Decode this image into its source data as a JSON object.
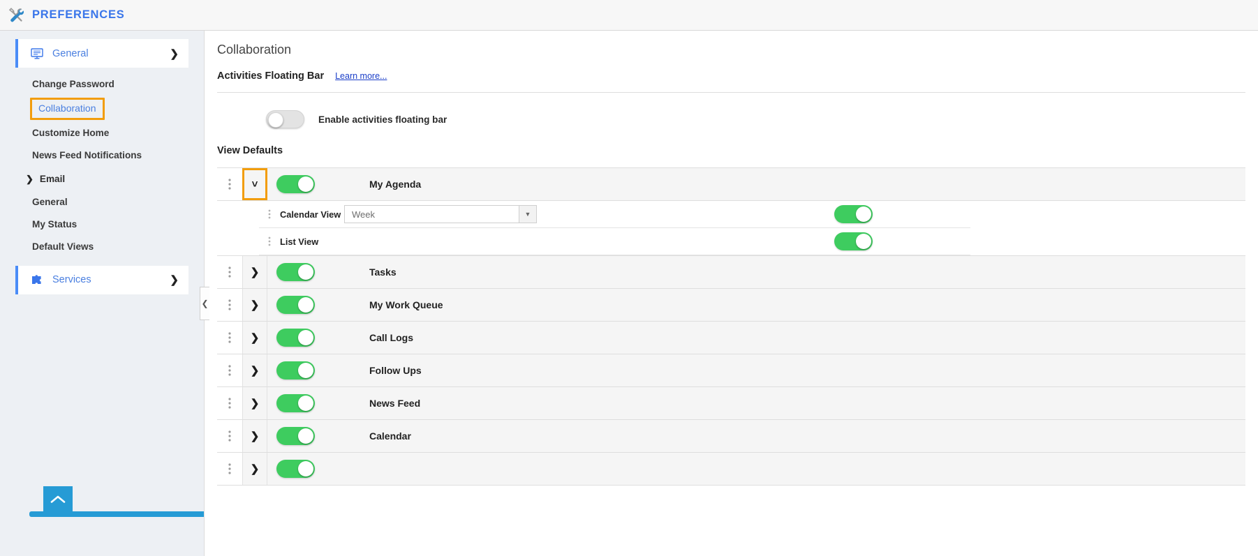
{
  "topbar": {
    "title": "PREFERENCES",
    "icon": "tools-icon"
  },
  "sidebar": {
    "groups": [
      {
        "label": "General",
        "icon": "monitor-icon",
        "chevron": "❯",
        "items": [
          {
            "label": "Change Password",
            "highlighted": false
          },
          {
            "label": "Collaboration",
            "highlighted": true
          },
          {
            "label": "Customize Home",
            "highlighted": false
          },
          {
            "label": "News Feed Notifications",
            "highlighted": false
          }
        ],
        "expandable": {
          "label": "Email",
          "chevron": "❯",
          "items": [
            {
              "label": "General"
            },
            {
              "label": "My Status"
            },
            {
              "label": "Default Views"
            }
          ]
        }
      },
      {
        "label": "Services",
        "icon": "puzzle-piece-icon",
        "chevron": "❯",
        "items": []
      }
    ],
    "collapse_handle": "❮",
    "scroll_top": "chevron-up-icon"
  },
  "main": {
    "page_title": "Collaboration",
    "floating_bar": {
      "heading": "Activities Floating Bar",
      "learn_more": "Learn more...",
      "toggle_state": "off",
      "toggle_label": "Enable activities floating bar"
    },
    "view_defaults": {
      "heading": "View Defaults",
      "rows": [
        {
          "label": "My Agenda",
          "toggle_state": "on",
          "expanded": true,
          "expander_icon": "chevron-down-icon",
          "expander_glyph": "˅",
          "expander_highlighted": true,
          "children": [
            {
              "label": "Calendar View",
              "has_select": true,
              "select_value": "Week",
              "select_arrow": "▼",
              "toggle_state": "on"
            },
            {
              "label": "List View",
              "has_select": false,
              "select_value": "",
              "toggle_state": "on"
            }
          ]
        },
        {
          "label": "Tasks",
          "toggle_state": "on",
          "expanded": false,
          "expander_icon": "chevron-right-icon",
          "expander_glyph": "❯",
          "expander_highlighted": false,
          "children": []
        },
        {
          "label": "My Work Queue",
          "toggle_state": "on",
          "expanded": false,
          "expander_icon": "chevron-right-icon",
          "expander_glyph": "❯",
          "expander_highlighted": false,
          "children": []
        },
        {
          "label": "Call Logs",
          "toggle_state": "on",
          "expanded": false,
          "expander_icon": "chevron-right-icon",
          "expander_glyph": "❯",
          "expander_highlighted": false,
          "children": []
        },
        {
          "label": "Follow Ups",
          "toggle_state": "on",
          "expanded": false,
          "expander_icon": "chevron-right-icon",
          "expander_glyph": "❯",
          "expander_highlighted": false,
          "children": []
        },
        {
          "label": "News Feed",
          "toggle_state": "on",
          "expanded": false,
          "expander_icon": "chevron-right-icon",
          "expander_glyph": "❯",
          "expander_highlighted": false,
          "children": []
        },
        {
          "label": "Calendar",
          "toggle_state": "on",
          "expanded": false,
          "expander_icon": "chevron-right-icon",
          "expander_glyph": "❯",
          "expander_highlighted": false,
          "children": []
        },
        {
          "label": "",
          "toggle_state": "on",
          "expanded": false,
          "expander_icon": "chevron-right-icon",
          "expander_glyph": "❯",
          "expander_highlighted": false,
          "children": []
        }
      ]
    }
  },
  "colors": {
    "accent_blue": "#3a76ea",
    "highlight_orange": "#f29d0d",
    "toggle_on_green": "#3ecc5f",
    "toggle_off_gray": "#e3e3e3",
    "sidebar_bg": "#edf0f4",
    "link_blue": "#1a3ec8",
    "button_blue": "#269bd5"
  }
}
